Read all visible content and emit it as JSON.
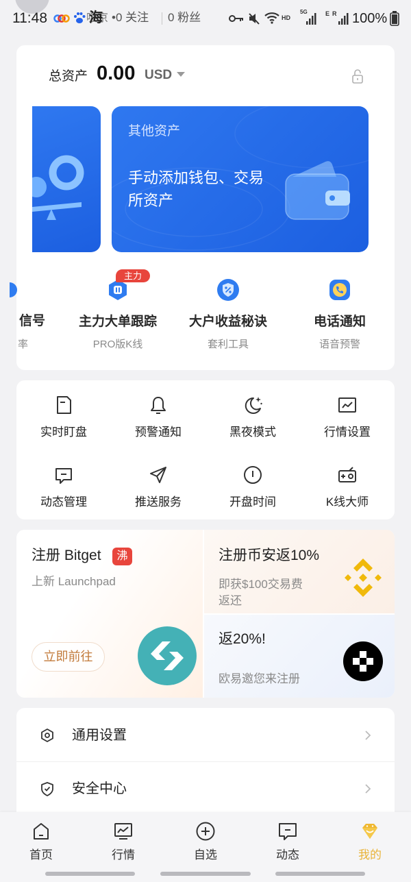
{
  "status_bar": {
    "time": "11:48",
    "notification_glyph": "海",
    "username_fragment": "吸京",
    "follow": "•0 关注",
    "fans": "0 粉丝",
    "wifi_label": "HD",
    "sim1_label": "5G",
    "sim2_label_e": "E",
    "sim2_label_r": "R",
    "battery": "100%"
  },
  "assets": {
    "label": "总资产",
    "value": "0.00",
    "currency": "USD",
    "privacy_icon": "unlock-icon"
  },
  "carousel": {
    "active_card": {
      "title": "其他资产",
      "description": "手动添加钱包、交易所资产",
      "icon": "wallet-icon"
    }
  },
  "features": [
    {
      "label": "信号",
      "sub": "率",
      "icon": "signal-icon"
    },
    {
      "label": "主力大单跟踪",
      "sub": "PRO版K线",
      "icon": "whale-tracking-icon",
      "badge": "主力"
    },
    {
      "label": "大户收益秘诀",
      "sub": "套利工具",
      "icon": "percent-shield-icon"
    },
    {
      "label": "电话通知",
      "sub": "语音预警",
      "icon": "phone-icon"
    }
  ],
  "tools": [
    {
      "label": "实时盯盘",
      "icon": "note-icon"
    },
    {
      "label": "预警通知",
      "icon": "bell-icon"
    },
    {
      "label": "黑夜模式",
      "icon": "moon-icon"
    },
    {
      "label": "行情设置",
      "icon": "chart-icon"
    },
    {
      "label": "动态管理",
      "icon": "message-icon"
    },
    {
      "label": "推送服务",
      "icon": "send-icon"
    },
    {
      "label": "开盘时间",
      "icon": "clock-icon"
    },
    {
      "label": "K线大师",
      "icon": "radio-icon"
    }
  ],
  "promo": {
    "bitget": {
      "title": "注册 Bitget",
      "badge": "沸",
      "subtitle": "上新 Launchpad",
      "button": "立即前往",
      "icon": "bitget-logo-icon"
    },
    "binance": {
      "title": "注册币安返10%",
      "subtitle": "即获$100交易费返还",
      "icon": "binance-logo-icon"
    },
    "okx": {
      "title": "返20%!",
      "subtitle": "欧易邀您来注册",
      "icon": "okx-logo-icon"
    }
  },
  "settings": [
    {
      "label": "通用设置",
      "icon": "hexagon-settings-icon"
    },
    {
      "label": "安全中心",
      "icon": "shield-check-icon"
    }
  ],
  "nav": [
    {
      "label": "首页",
      "icon": "home-icon"
    },
    {
      "label": "行情",
      "icon": "market-chart-icon"
    },
    {
      "label": "自选",
      "icon": "plus-circle-icon"
    },
    {
      "label": "动态",
      "icon": "message-icon"
    },
    {
      "label": "我的",
      "icon": "gem-icon",
      "active": true
    }
  ],
  "colors": {
    "primary_blue": "#2468e6",
    "badge_red": "#e8453c",
    "active_gold": "#e9b43a",
    "bitget_teal": "#44b1b6",
    "binance_gold": "#f0b90b"
  }
}
